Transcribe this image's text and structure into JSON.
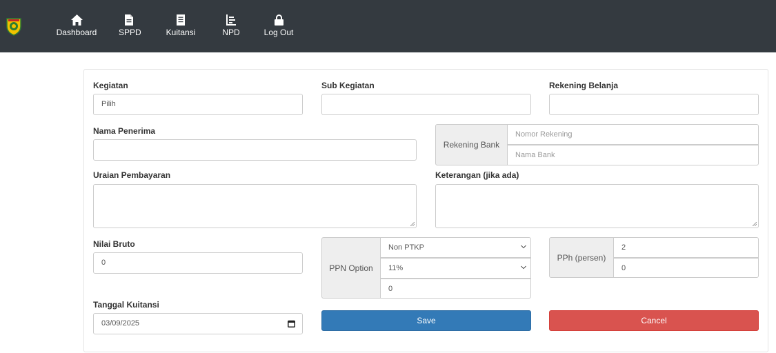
{
  "nav": {
    "items": [
      {
        "label": "Dashboard",
        "icon": "home-icon"
      },
      {
        "label": "SPPD",
        "icon": "document-icon"
      },
      {
        "label": "Kuitansi",
        "icon": "receipt-icon"
      },
      {
        "label": "NPD",
        "icon": "chart-icon"
      },
      {
        "label": "Log Out",
        "icon": "lock-icon"
      }
    ]
  },
  "form": {
    "kegiatan": {
      "label": "Kegiatan",
      "value": "Pilih"
    },
    "sub_kegiatan": {
      "label": "Sub Kegiatan",
      "value": ""
    },
    "rekening_belanja": {
      "label": "Rekening Belanja",
      "value": ""
    },
    "nama_penerima": {
      "label": "Nama Penerima",
      "value": ""
    },
    "rekening_bank": {
      "addon": "Rekening Bank",
      "nomor_placeholder": "Nomor Rekening",
      "nama_placeholder": "Nama Bank"
    },
    "uraian": {
      "label": "Uraian Pembayaran",
      "value": ""
    },
    "keterangan": {
      "label": "Keterangan (jika ada)",
      "value": ""
    },
    "nilai_bruto": {
      "label": "Nilai Bruto",
      "value": "0"
    },
    "ppn": {
      "addon": "PPN Option",
      "option_value": "Non PTKP",
      "rate_value": "11%",
      "amount_value": "0"
    },
    "pph": {
      "addon": "PPh (persen)",
      "rate_value": "2",
      "amount_value": "0"
    },
    "tanggal": {
      "label": "Tanggal Kuitansi",
      "value": "03/09/2025"
    },
    "save_label": "Save",
    "cancel_label": "Cancel"
  },
  "colors": {
    "navbar": "#343a40",
    "save": "#337ab7",
    "cancel": "#d9534f"
  }
}
